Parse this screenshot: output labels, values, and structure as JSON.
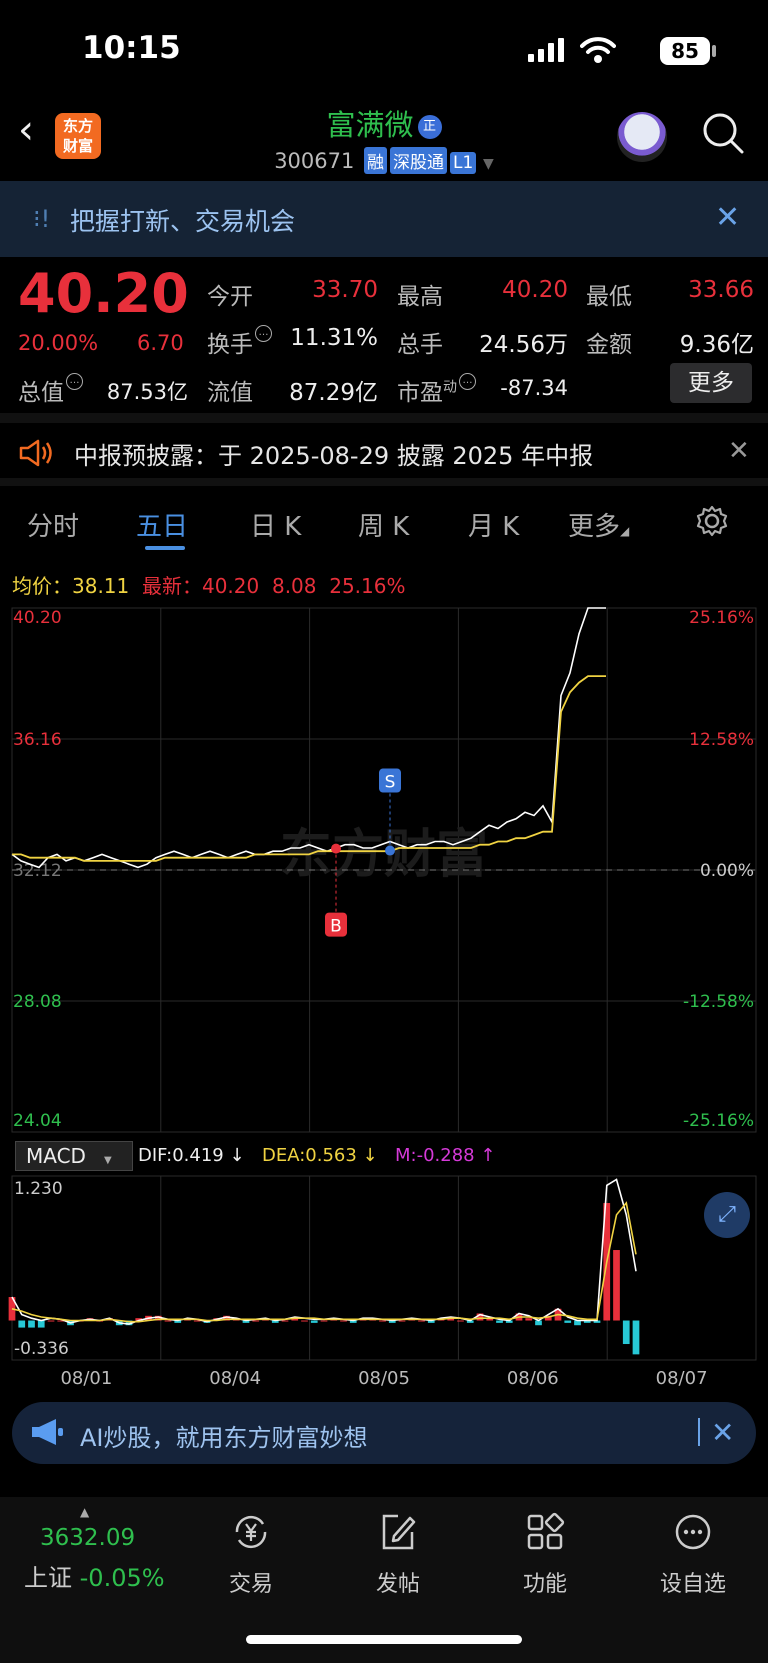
{
  "status": {
    "time": "10:15",
    "battery": "85"
  },
  "header": {
    "logo_text": "东方财富",
    "stock_name": "富满微",
    "stock_badge": "正",
    "stock_code": "300671",
    "tags": [
      "融",
      "深股通",
      "L1"
    ]
  },
  "banner": {
    "text": "把握打新、交易机会"
  },
  "quote": {
    "price": "40.20",
    "change_pct": "20.00%",
    "change": "6.70",
    "open_label": "今开",
    "open": "33.70",
    "high_label": "最高",
    "high": "40.20",
    "low_label": "最低",
    "low": "33.66",
    "turnover_label": "换手",
    "turnover": "11.31%",
    "volume_label": "总手",
    "volume": "24.56万",
    "amount_label": "金额",
    "amount": "9.36亿",
    "mktcap_label": "总值",
    "mktcap": "87.53亿",
    "float_label": "流值",
    "float": "87.29亿",
    "pe_label": "市盈",
    "pe_sup": "动",
    "pe": "-87.34",
    "more": "更多"
  },
  "notice": {
    "text": "中报预披露：于 2025-08-29 披露 2025 年中报"
  },
  "tabs": [
    "分时",
    "五日",
    "日 K",
    "周 K",
    "月 K",
    "更多"
  ],
  "active_tab": "五日",
  "summary": {
    "avg_label": "均价：",
    "avg": "38.11",
    "latest_label": "最新：",
    "latest": "40.20",
    "latest_chg": "8.08",
    "latest_pct": "25.16%"
  },
  "chart_data": {
    "type": "line",
    "title": "",
    "x_labels": [
      "08/01",
      "08/04",
      "08/05",
      "08/06",
      "08/07"
    ],
    "y_left_ticks": [
      "40.20",
      "36.16",
      "32.12",
      "28.08",
      "24.04"
    ],
    "y_right_ticks": [
      "25.16%",
      "12.58%",
      "0.00%",
      "-12.58%",
      "-25.16%"
    ],
    "ylim": [
      24.04,
      40.2
    ],
    "base": 32.12,
    "watermark": "东方财富",
    "series": [
      {
        "name": "price",
        "color": "#ffffff",
        "values": [
          32.6,
          32.4,
          32.3,
          32.2,
          32.5,
          32.6,
          32.4,
          32.5,
          32.4,
          32.5,
          32.6,
          32.5,
          32.4,
          32.3,
          32.2,
          32.3,
          32.5,
          32.6,
          32.7,
          32.6,
          32.5,
          32.6,
          32.7,
          32.6,
          32.5,
          32.6,
          32.7,
          32.6,
          32.6,
          32.7,
          32.7,
          32.8,
          32.8,
          32.9,
          32.8,
          32.7,
          32.8,
          32.9,
          32.9,
          32.8,
          32.8,
          32.9,
          33.0,
          32.9,
          32.8,
          32.9,
          32.9,
          33.0,
          33.0,
          32.9,
          33.0,
          33.1,
          33.3,
          33.5,
          33.4,
          33.6,
          33.7,
          33.9,
          33.8,
          34.1,
          33.6,
          37.5,
          38.2,
          39.4,
          40.2,
          40.2,
          40.2
        ]
      },
      {
        "name": "avg",
        "color": "#f0d342",
        "values": [
          32.6,
          32.6,
          32.5,
          32.5,
          32.5,
          32.5,
          32.5,
          32.5,
          32.4,
          32.4,
          32.4,
          32.4,
          32.4,
          32.4,
          32.4,
          32.4,
          32.4,
          32.5,
          32.5,
          32.5,
          32.5,
          32.5,
          32.5,
          32.5,
          32.5,
          32.5,
          32.5,
          32.6,
          32.6,
          32.6,
          32.6,
          32.6,
          32.6,
          32.6,
          32.7,
          32.7,
          32.7,
          32.7,
          32.7,
          32.7,
          32.7,
          32.7,
          32.7,
          32.8,
          32.8,
          32.8,
          32.8,
          32.8,
          32.8,
          32.8,
          32.8,
          32.8,
          32.9,
          32.9,
          33.0,
          33.0,
          33.1,
          33.1,
          33.2,
          33.3,
          33.3,
          37.0,
          37.6,
          37.9,
          38.1,
          38.1,
          38.1
        ]
      }
    ],
    "markers": [
      {
        "label": "B",
        "x_index": 36,
        "price": 32.78,
        "color": "#e8303b",
        "direction": "down"
      },
      {
        "label": "S",
        "x_index": 42,
        "price": 32.72,
        "color": "#3a75d6",
        "direction": "up"
      }
    ],
    "macd": {
      "indicator": "MACD",
      "dif_label": "DIF:0.419 ↓",
      "dea_label": "DEA:0.563 ↓",
      "m_label": "M:-0.288 ↑",
      "y_ticks": [
        "1.230",
        "-0.336"
      ],
      "ylim": [
        -0.336,
        1.23
      ],
      "dif": [
        0.2,
        0.05,
        0.02,
        0.0,
        0.02,
        0.01,
        -0.02,
        0.0,
        0.01,
        0.0,
        0.02,
        -0.02,
        -0.03,
        0.0,
        0.02,
        0.03,
        0.01,
        0.0,
        0.02,
        0.01,
        -0.01,
        0.01,
        0.03,
        0.02,
        0.0,
        0.01,
        0.02,
        0.0,
        0.01,
        0.03,
        0.02,
        0.01,
        0.01,
        0.02,
        0.01,
        0.0,
        0.02,
        0.02,
        0.01,
        0.0,
        0.01,
        0.02,
        0.01,
        0.0,
        0.02,
        0.03,
        0.02,
        0.0,
        0.05,
        0.03,
        0.01,
        0.0,
        0.06,
        0.04,
        0.0,
        0.05,
        0.1,
        0.03,
        0.0,
        0.0,
        0.0,
        1.15,
        1.2,
        0.9,
        0.419
      ],
      "dea": [
        0.1,
        0.08,
        0.05,
        0.03,
        0.02,
        0.01,
        0.0,
        0.0,
        0.0,
        0.0,
        0.01,
        0.0,
        -0.01,
        -0.01,
        0.0,
        0.01,
        0.01,
        0.01,
        0.01,
        0.01,
        0.0,
        0.0,
        0.01,
        0.01,
        0.01,
        0.01,
        0.01,
        0.01,
        0.01,
        0.02,
        0.02,
        0.02,
        0.01,
        0.01,
        0.01,
        0.01,
        0.01,
        0.01,
        0.01,
        0.01,
        0.01,
        0.01,
        0.01,
        0.01,
        0.01,
        0.02,
        0.02,
        0.01,
        0.02,
        0.02,
        0.02,
        0.01,
        0.03,
        0.03,
        0.02,
        0.03,
        0.05,
        0.04,
        0.02,
        0.01,
        0.01,
        0.5,
        0.9,
        1.0,
        0.563
      ],
      "m": [
        0.2,
        -0.06,
        -0.06,
        -0.06,
        0.0,
        0.0,
        -0.04,
        0.0,
        0.02,
        0.0,
        0.02,
        -0.04,
        -0.04,
        0.02,
        0.04,
        0.04,
        0.0,
        -0.02,
        0.02,
        0.0,
        -0.02,
        0.02,
        0.04,
        0.02,
        -0.02,
        0.0,
        0.02,
        -0.02,
        0.0,
        0.02,
        0.0,
        -0.02,
        0.0,
        0.02,
        0.0,
        -0.02,
        0.02,
        0.02,
        0.0,
        -0.02,
        0.0,
        0.02,
        0.0,
        -0.02,
        0.02,
        0.02,
        0.0,
        -0.02,
        0.06,
        0.02,
        -0.02,
        -0.02,
        0.06,
        0.02,
        -0.04,
        0.04,
        0.1,
        -0.02,
        -0.04,
        -0.02,
        -0.02,
        1.0,
        0.6,
        -0.2,
        -0.288
      ]
    }
  },
  "ai_bar": {
    "text": "AI炒股，就用东方财富妙想"
  },
  "bottom": {
    "index_value": "3632.09",
    "index_name": "上证",
    "index_change": "-0.05%",
    "nav": [
      {
        "label": "交易",
        "icon": "yen-trade-icon"
      },
      {
        "label": "发帖",
        "icon": "edit-icon"
      },
      {
        "label": "功能",
        "icon": "grid-icon"
      },
      {
        "label": "设自选",
        "icon": "more-dots-icon"
      }
    ]
  }
}
